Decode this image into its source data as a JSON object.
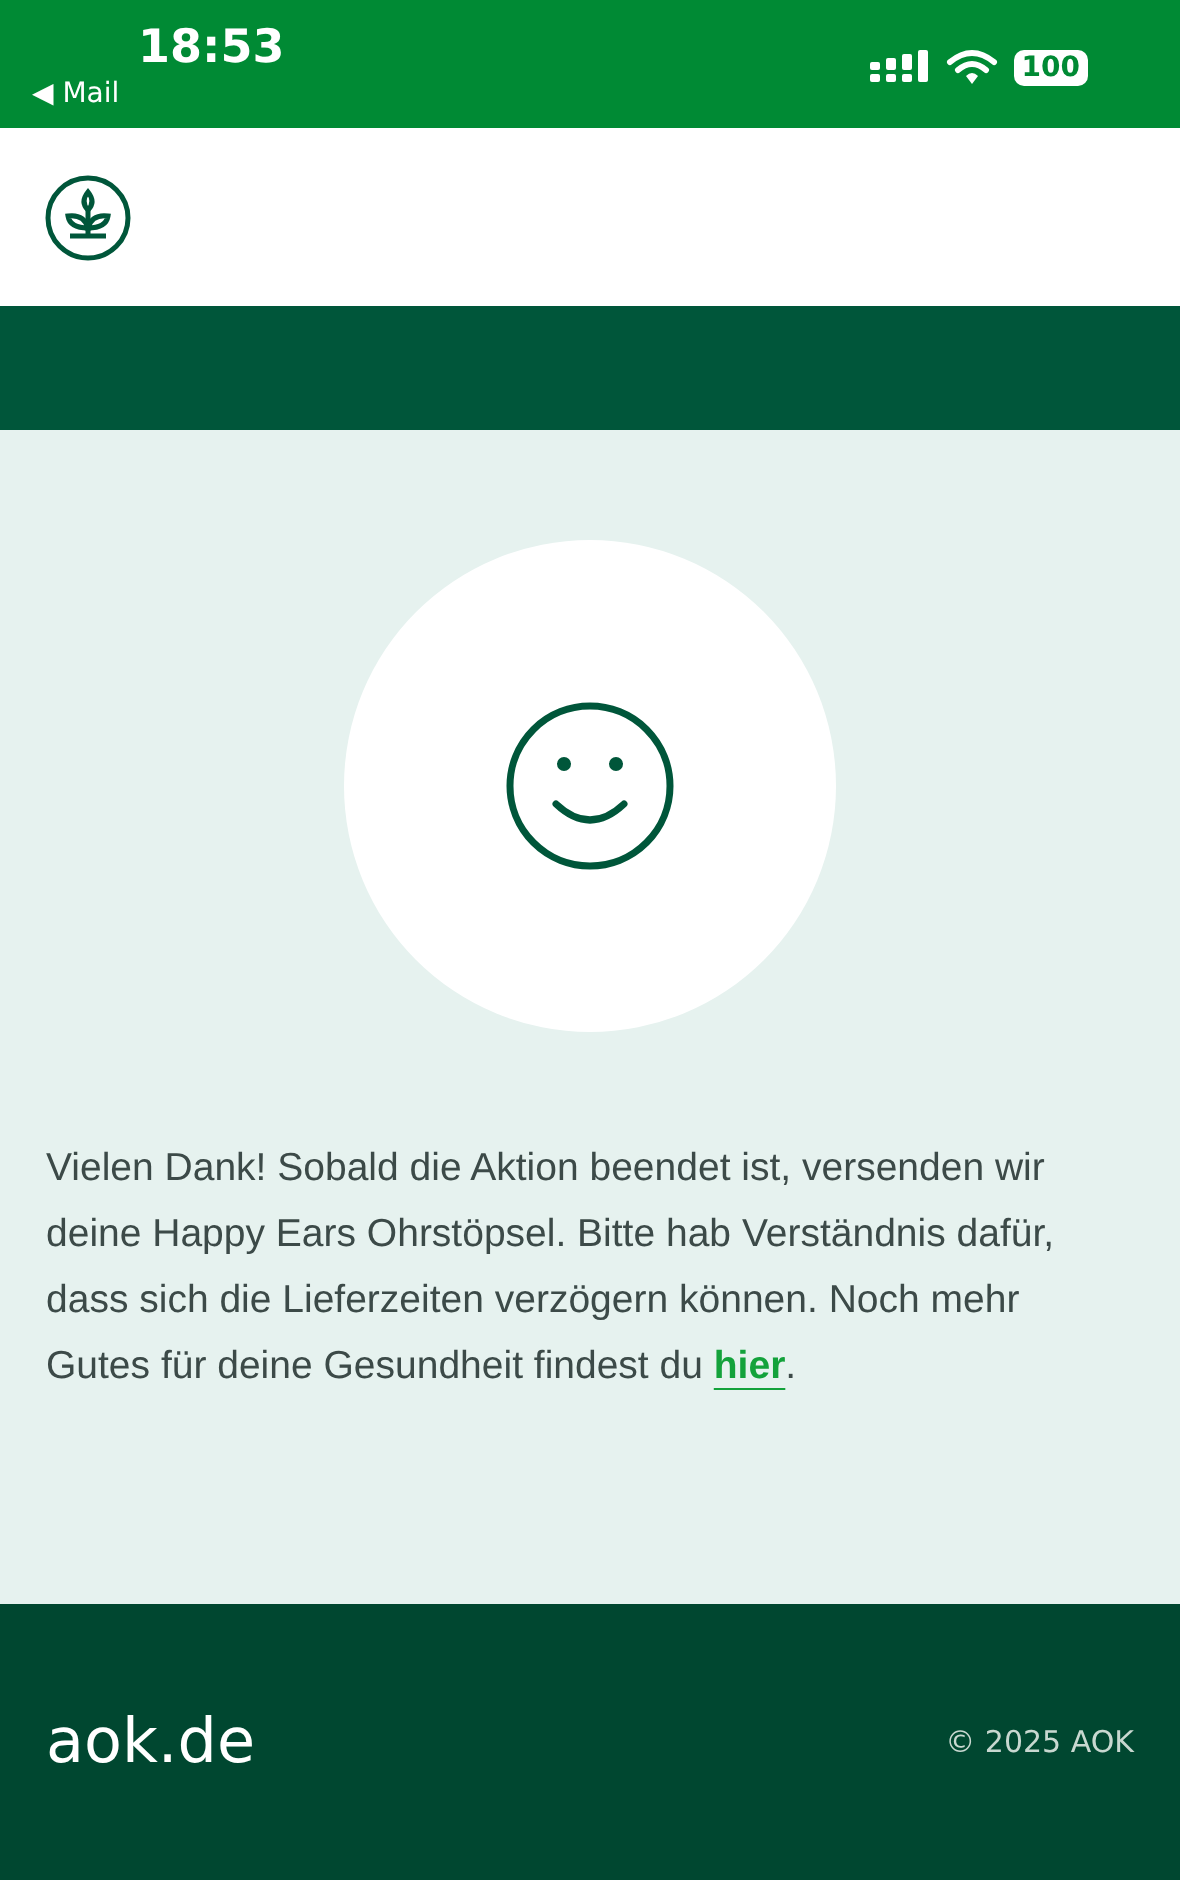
{
  "status_bar": {
    "time": "18:53",
    "back_label": "◀ Mail",
    "battery": "100"
  },
  "message": {
    "text_before": "Vielen Dank! Sobald die Aktion beendet ist, versenden wir deine Happy Ears Ohrstöpsel. Bitte hab Verständnis dafür, dass sich die Lieferzeiten verzögern können. Noch mehr Gutes für deine Gesundheit findest du ",
    "link": "hier",
    "text_after": "."
  },
  "footer": {
    "domain": "aok.de",
    "copyright": "© 2025 AOK"
  }
}
